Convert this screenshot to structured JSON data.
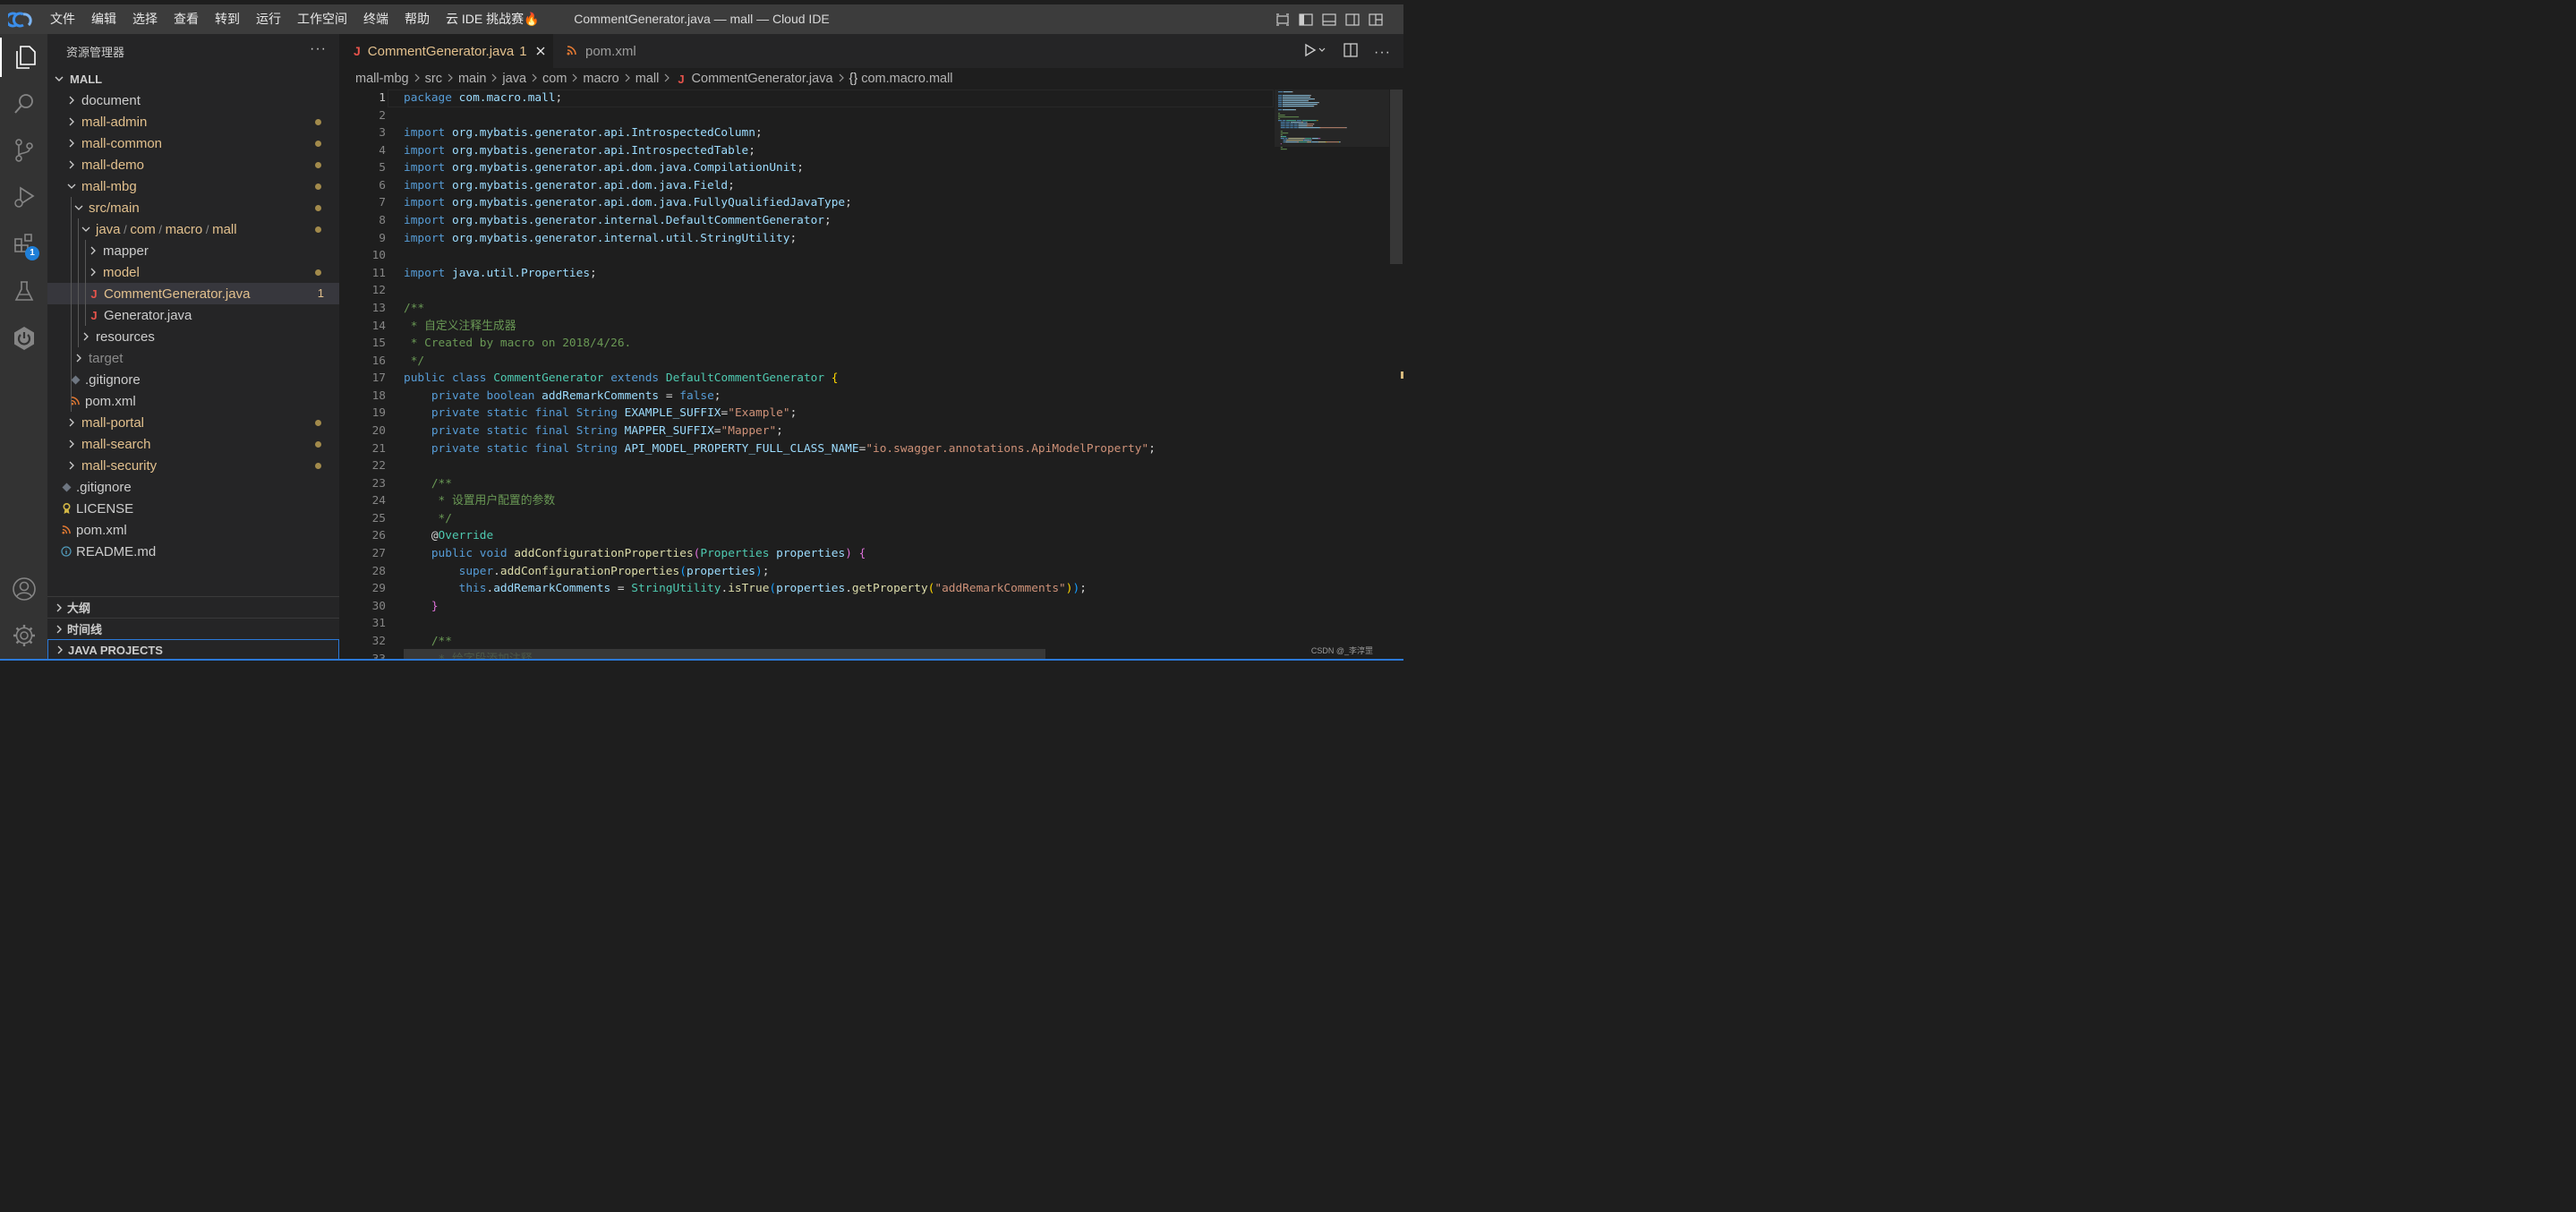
{
  "titlebar": {
    "menu": [
      "文件",
      "编辑",
      "选择",
      "查看",
      "转到",
      "运行",
      "工作空间",
      "终端",
      "帮助",
      "云 IDE 挑战赛🔥"
    ],
    "title": "CommentGenerator.java — mall — Cloud IDE"
  },
  "activity": {
    "extensions_badge": "1"
  },
  "sidebar": {
    "header": "资源管理器",
    "more": "···",
    "root": "MALL",
    "tree": [
      {
        "label": "document",
        "indent": 0,
        "kind": "folder",
        "open": false,
        "color": "norm",
        "dot": false
      },
      {
        "label": "mall-admin",
        "indent": 0,
        "kind": "folder",
        "open": false,
        "color": "mod",
        "dot": true
      },
      {
        "label": "mall-common",
        "indent": 0,
        "kind": "folder",
        "open": false,
        "color": "mod",
        "dot": true
      },
      {
        "label": "mall-demo",
        "indent": 0,
        "kind": "folder",
        "open": false,
        "color": "mod",
        "dot": true
      },
      {
        "label": "mall-mbg",
        "indent": 0,
        "kind": "folder",
        "open": true,
        "color": "mod",
        "dot": true
      },
      {
        "label": "src/main",
        "indent": 1,
        "kind": "folder",
        "open": true,
        "color": "mod",
        "dot": true
      },
      {
        "label": "java/com/macro/mall",
        "indent": 2,
        "kind": "folder",
        "open": true,
        "color": "mod",
        "dot": true
      },
      {
        "label": "mapper",
        "indent": 3,
        "kind": "folder",
        "open": false,
        "color": "norm",
        "dot": false
      },
      {
        "label": "model",
        "indent": 3,
        "kind": "folder",
        "open": false,
        "color": "mod",
        "dot": true
      },
      {
        "label": "CommentGenerator.java",
        "indent": 3,
        "kind": "java",
        "color": "mod",
        "count": "1",
        "selected": true
      },
      {
        "label": "Generator.java",
        "indent": 3,
        "kind": "java",
        "color": "norm"
      },
      {
        "label": "resources",
        "indent": 2,
        "kind": "folder",
        "open": false,
        "color": "norm",
        "dot": false
      },
      {
        "label": "target",
        "indent": 1,
        "kind": "folder",
        "open": false,
        "color": "dim",
        "dot": false
      },
      {
        "label": ".gitignore",
        "indent": 1,
        "kind": "git",
        "color": "norm"
      },
      {
        "label": "pom.xml",
        "indent": 1,
        "kind": "rss",
        "color": "norm"
      },
      {
        "label": "mall-portal",
        "indent": 0,
        "kind": "folder",
        "open": false,
        "color": "mod",
        "dot": true
      },
      {
        "label": "mall-search",
        "indent": 0,
        "kind": "folder",
        "open": false,
        "color": "mod",
        "dot": true
      },
      {
        "label": "mall-security",
        "indent": 0,
        "kind": "folder",
        "open": false,
        "color": "mod",
        "dot": true
      },
      {
        "label": ".gitignore",
        "indent": 0,
        "kind": "git",
        "color": "norm",
        "file": true
      },
      {
        "label": "LICENSE",
        "indent": 0,
        "kind": "license",
        "color": "norm",
        "file": true
      },
      {
        "label": "pom.xml",
        "indent": 0,
        "kind": "rss",
        "color": "norm",
        "file": true
      },
      {
        "label": "README.md",
        "indent": 0,
        "kind": "info",
        "color": "norm",
        "file": true
      }
    ],
    "sections": [
      "大纲",
      "时间线",
      "JAVA PROJECTS"
    ]
  },
  "tabs": [
    {
      "label": "CommentGenerator.java",
      "count": "1",
      "active": true
    },
    {
      "label": "pom.xml",
      "active": false
    }
  ],
  "breadcrumb": [
    "mall-mbg",
    "src",
    "main",
    "java",
    "com",
    "macro",
    "mall",
    "CommentGenerator.java",
    "com.macro.mall"
  ],
  "editor": {
    "current_line": 1,
    "lines": [
      [
        [
          "kw",
          "package"
        ],
        [
          "t",
          " "
        ],
        [
          "ns",
          "com.macro.mall"
        ],
        [
          "t",
          ";"
        ]
      ],
      [],
      [
        [
          "kw",
          "import"
        ],
        [
          "t",
          " "
        ],
        [
          "ns",
          "org.mybatis.generator.api.IntrospectedColumn"
        ],
        [
          "t",
          ";"
        ]
      ],
      [
        [
          "kw",
          "import"
        ],
        [
          "t",
          " "
        ],
        [
          "ns",
          "org.mybatis.generator.api.IntrospectedTable"
        ],
        [
          "t",
          ";"
        ]
      ],
      [
        [
          "kw",
          "import"
        ],
        [
          "t",
          " "
        ],
        [
          "ns",
          "org.mybatis.generator.api.dom.java.CompilationUnit"
        ],
        [
          "t",
          ";"
        ]
      ],
      [
        [
          "kw",
          "import"
        ],
        [
          "t",
          " "
        ],
        [
          "ns",
          "org.mybatis.generator.api.dom.java.Field"
        ],
        [
          "t",
          ";"
        ]
      ],
      [
        [
          "kw",
          "import"
        ],
        [
          "t",
          " "
        ],
        [
          "ns",
          "org.mybatis.generator.api.dom.java.FullyQualifiedJavaType"
        ],
        [
          "t",
          ";"
        ]
      ],
      [
        [
          "kw",
          "import"
        ],
        [
          "t",
          " "
        ],
        [
          "ns",
          "org.mybatis.generator.internal.DefaultCommentGenerator"
        ],
        [
          "t",
          ";"
        ]
      ],
      [
        [
          "kw",
          "import"
        ],
        [
          "t",
          " "
        ],
        [
          "ns",
          "org.mybatis.generator.internal.util.StringUtility"
        ],
        [
          "t",
          ";"
        ]
      ],
      [],
      [
        [
          "kw",
          "import"
        ],
        [
          "t",
          " "
        ],
        [
          "ns",
          "java.util.Properties"
        ],
        [
          "t",
          ";"
        ]
      ],
      [],
      [
        [
          "cm",
          "/**"
        ]
      ],
      [
        [
          "cm",
          " * 自定义注释生成器"
        ]
      ],
      [
        [
          "cm",
          " * Created by macro on 2018/4/26."
        ]
      ],
      [
        [
          "cm",
          " */"
        ]
      ],
      [
        [
          "kw",
          "public"
        ],
        [
          "t",
          " "
        ],
        [
          "kw",
          "class"
        ],
        [
          "t",
          " "
        ],
        [
          "ty",
          "CommentGenerator"
        ],
        [
          "t",
          " "
        ],
        [
          "kw",
          "extends"
        ],
        [
          "t",
          " "
        ],
        [
          "ty",
          "DefaultCommentGenerator"
        ],
        [
          "t",
          " "
        ],
        [
          "br",
          "{"
        ]
      ],
      [
        [
          "t",
          "    "
        ],
        [
          "kw",
          "private"
        ],
        [
          "t",
          " "
        ],
        [
          "kw",
          "boolean"
        ],
        [
          "t",
          " "
        ],
        [
          "var",
          "addRemarkComments"
        ],
        [
          "t",
          " = "
        ],
        [
          "kw",
          "false"
        ],
        [
          "t",
          ";"
        ]
      ],
      [
        [
          "t",
          "    "
        ],
        [
          "kw",
          "private"
        ],
        [
          "t",
          " "
        ],
        [
          "kw",
          "static"
        ],
        [
          "t",
          " "
        ],
        [
          "kw",
          "final"
        ],
        [
          "t",
          " "
        ],
        [
          "kw",
          "String"
        ],
        [
          "t",
          " "
        ],
        [
          "var",
          "EXAMPLE_SUFFIX"
        ],
        [
          "t",
          "="
        ],
        [
          "str",
          "\"Example\""
        ],
        [
          "t",
          ";"
        ]
      ],
      [
        [
          "t",
          "    "
        ],
        [
          "kw",
          "private"
        ],
        [
          "t",
          " "
        ],
        [
          "kw",
          "static"
        ],
        [
          "t",
          " "
        ],
        [
          "kw",
          "final"
        ],
        [
          "t",
          " "
        ],
        [
          "kw",
          "String"
        ],
        [
          "t",
          " "
        ],
        [
          "var",
          "MAPPER_SUFFIX"
        ],
        [
          "t",
          "="
        ],
        [
          "str",
          "\"Mapper\""
        ],
        [
          "t",
          ";"
        ]
      ],
      [
        [
          "t",
          "    "
        ],
        [
          "kw",
          "private"
        ],
        [
          "t",
          " "
        ],
        [
          "kw",
          "static"
        ],
        [
          "t",
          " "
        ],
        [
          "kw",
          "final"
        ],
        [
          "t",
          " "
        ],
        [
          "kw",
          "String"
        ],
        [
          "t",
          " "
        ],
        [
          "var",
          "API_MODEL_PROPERTY_FULL_CLASS_NAME"
        ],
        [
          "t",
          "="
        ],
        [
          "str",
          "\"io.swagger.annotations.ApiModelProperty\""
        ],
        [
          "t",
          ";"
        ]
      ],
      [],
      [
        [
          "t",
          "    "
        ],
        [
          "cm",
          "/**"
        ]
      ],
      [
        [
          "t",
          "    "
        ],
        [
          "cm",
          " * 设置用户配置的参数"
        ]
      ],
      [
        [
          "t",
          "    "
        ],
        [
          "cm",
          " */"
        ]
      ],
      [
        [
          "t",
          "    "
        ],
        [
          "t",
          "@"
        ],
        [
          "ty",
          "Override"
        ]
      ],
      [
        [
          "t",
          "    "
        ],
        [
          "kw",
          "public"
        ],
        [
          "t",
          " "
        ],
        [
          "kw",
          "void"
        ],
        [
          "t",
          " "
        ],
        [
          "fn",
          "addConfigurationProperties"
        ],
        [
          "br2",
          "("
        ],
        [
          "ty",
          "Properties"
        ],
        [
          "t",
          " "
        ],
        [
          "var",
          "properties"
        ],
        [
          "br2",
          ")"
        ],
        [
          "t",
          " "
        ],
        [
          "br2",
          "{"
        ]
      ],
      [
        [
          "t",
          "        "
        ],
        [
          "kw",
          "super"
        ],
        [
          "t",
          "."
        ],
        [
          "fn",
          "addConfigurationProperties"
        ],
        [
          "br3",
          "("
        ],
        [
          "var",
          "properties"
        ],
        [
          "br3",
          ")"
        ],
        [
          "t",
          ";"
        ]
      ],
      [
        [
          "t",
          "        "
        ],
        [
          "kw",
          "this"
        ],
        [
          "t",
          "."
        ],
        [
          "var",
          "addRemarkComments"
        ],
        [
          "t",
          " = "
        ],
        [
          "ty",
          "StringUtility"
        ],
        [
          "t",
          "."
        ],
        [
          "fn",
          "isTrue"
        ],
        [
          "br3",
          "("
        ],
        [
          "var",
          "properties"
        ],
        [
          "t",
          "."
        ],
        [
          "fn",
          "getProperty"
        ],
        [
          "br",
          "("
        ],
        [
          "str",
          "\"addRemarkComments\""
        ],
        [
          "br",
          ")"
        ],
        [
          "br3",
          ")"
        ],
        [
          "t",
          ";"
        ]
      ],
      [
        [
          "t",
          "    "
        ],
        [
          "br2",
          "}"
        ]
      ],
      [],
      [
        [
          "t",
          "    "
        ],
        [
          "cm",
          "/**"
        ]
      ],
      [
        [
          "t",
          "    "
        ],
        [
          "cm",
          " * 给字段添加注释"
        ]
      ]
    ]
  },
  "watermark": "CSDN @_李淳罡",
  "colors": {
    "kw": "#569cd6",
    "ns": "#9cdcfe",
    "ty": "#4ec9b0",
    "fn": "#dcdcaa",
    "var": "#9cdcfe",
    "str": "#ce9178",
    "cm": "#6a9955",
    "br": "#ffd700",
    "br2": "#da70d6",
    "br3": "#179fff",
    "t": "#d4d4d4"
  }
}
